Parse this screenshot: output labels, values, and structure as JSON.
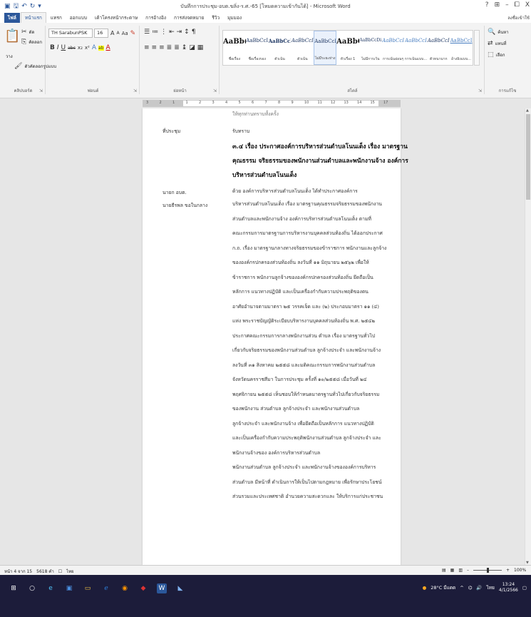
{
  "titlebar": {
    "title": "บันทึกการประชุม-อบต.ฆลิ่ง-ร.ศ.-65 [โหมดความเข้ากันได้] - Microsoft Word",
    "help": "?",
    "restore_ribbon": "⊞",
    "minimize": "–",
    "maximize": "⧠",
    "close": "X"
  },
  "tabs": [
    "ไฟล์",
    "หน้าแรก",
    "แทรก",
    "ออกแบบ",
    "เค้าโครงหน้ากระดาษ",
    "การอ้างอิง",
    "การส่งจดหมาย",
    "รีวิว",
    "มุมมอง"
  ],
  "user": "ลงชื่อเข้าใช้",
  "ribbon": {
    "clipboard": {
      "label": "คลิปบอร์ด",
      "paste": "วาง",
      "cut": "ตัด",
      "copy": "คัดลอก",
      "format_painter": "ตัวคัดลอกรูปแบบ"
    },
    "font": {
      "label": "ฟอนต์",
      "name": "TH SarabunPSK",
      "size": "16",
      "grow": "A",
      "shrink": "A",
      "case": "Aa",
      "clear": "✎",
      "bold": "B",
      "italic": "I",
      "underline": "U",
      "strike": "abc",
      "sub": "x₂",
      "sup": "x²",
      "effects": "A",
      "highlight": "ab",
      "color": "A"
    },
    "paragraph": {
      "label": "ย่อหน้า"
    },
    "styles": {
      "label": "สไตล์",
      "items": [
        {
          "sample": "AaBb(",
          "name": "ชื่อเรื่อง"
        },
        {
          "sample": "AaBbCcI",
          "name": "ชื่อเรื่องรอง"
        },
        {
          "sample": "AaBbCcl",
          "name": "ตัวเน้น"
        },
        {
          "sample": "AaBbCcI",
          "name": "ตัวเน้น"
        },
        {
          "sample": "AaBbCcI",
          "name": "ไม่มีระยะห่าง"
        },
        {
          "sample": "AaBbC",
          "name": "หัวเรื่อง 1"
        },
        {
          "sample": "AaBbCcDi",
          "name": "ไม่มีการเว้น"
        },
        {
          "sample": "AaBbCcI",
          "name": "การเน้นอ่อนๆ"
        },
        {
          "sample": "AaBbCcI",
          "name": "การเน้นแบบ..."
        },
        {
          "sample": "AaBbCcI",
          "name": "ตัวหนามาก"
        },
        {
          "sample": "AaBbCcI",
          "name": "อ้างอิงแบบ..."
        }
      ]
    },
    "editing": {
      "label": "การแก้ไข",
      "find": "ค้นหา",
      "replace": "แทนที่",
      "select": "เลือก"
    }
  },
  "ruler": {
    "numbers": [
      "3",
      "2",
      "1",
      "1",
      "2",
      "3",
      "4",
      "5",
      "6",
      "7",
      "8",
      "9",
      "10",
      "11",
      "12",
      "13",
      "14",
      "15",
      "17"
    ]
  },
  "document": {
    "top_lines": [
      "ให้ทุกท่านทราบทั้งครั้ง"
    ],
    "meeting_label": "ที่ประชุม",
    "meeting_value": "รับทราบ",
    "heading_lines": [
      "๓.๔ เรื่อง ประกาศองค์การบริหารส่วนตำบลโนนเต็ง เรื่อง มาตรฐาน",
      "คุณธรรม จริยธรรมของพนักงานส่วนตำบลและพนักงานจ้าง องค์การ",
      "บริหารส่วนตำบลโนนเต็ง"
    ],
    "speaker1": "นายก อบต.",
    "speaker1_line": "ด้วย องค์การบริหารส่วนตำบลโนนเต็ง ได้ทำประกาศองค์การ",
    "speaker2": "นายธีรพล ขอในกลาง",
    "body_lines": [
      "บริหารส่วนตำบลโนนเต็ง เรื่อง มาตรฐานคุณธรรมจริยธรรมของพนักงาน",
      "ส่วนตำบลและพนักงานจ้าง องค์การบริหารส่วนตำบลโนนเต็ง ตามที่",
      "คณะกรรมการมาตรฐานการบริหารงานบุคคลส่วนท้องถิ่น ได้ออกประกาศ",
      "ก.ถ. เรื่อง มาตรฐานกลางทางจริยธรรมของข้าราชการ พนักงานและลูกจ้าง",
      "ขององค์กรปกครองส่วนท้องถิ่น ลงวันที่ ๑๑ มิถุนายน ๒๕๖๒ เพื่อให้",
      "ข้าราชการ พนักงานลูกจ้างขององค์กรปกครองส่วนท้องถิ่น ยึดถือเป็น",
      "หลักการ แนวทางปฏิบัติ และเป็นเครื่องกำกับความประพฤติของตน",
      "อาศัยอำนาจตามมาตรา ๒๕ วรรคเจ็ด และ (๒) ประกอบมาตรา ๑๑ (๔)",
      "แห่ง พระราชบัญญัติระเบียบบริหารงานบุคคลส่วนท้องถิ่น พ.ศ. ๒๕๔๒",
      "ประกาศคณะกรรมการกลางพนักงานส่วน ตำบล เรื่อง มาตรฐานทั่วไป",
      "เกี่ยวกับจริยธรรมของพนักงานส่วนตำบล ลูกจ้างประจำ และพนักงานจ้าง",
      "ลงวันที่ ๓๑ สิงหาคม ๒๕๕๘ และมติคณะกรรมการพนักงานส่วนตำบล",
      "จังหวัดนครราชสีมา ในการประชุม ครั้งที่ ๑๐/๒๕๕๘ เมื่อวันที่ ๒๔",
      "พฤศจิกายน ๒๕๕๘ เห็นชอบให้กำหนดมาตรฐานทั่วไปเกี่ยวกับจริยธรรม",
      "ของพนักงาน ส่วนตำบล ลูกจ้างประจำ และพนักงานส่วนตำบล",
      "ลูกจ้างประจำ และพนักงานจ้าง เพื่อยึดถือเป็นหลักการ แนวทางปฏิบัติ",
      "และเป็นเครื่องกำกับความประพฤติพนักงานส่วนตำบล ลูกจ้างประจำ และ",
      "พนักงานจ้างของ องค์การบริหารส่วนตำบล",
      "พนักงานส่วนตำบล ลูกจ้างประจำ และพนักงานจ้างขององค์การบริหาร",
      "ส่วนตำบล มีหน้าที่ ดำเนินการให้เป็นไปตามกฎหมาย เพื่อรักษาประโยชน์",
      "ส่วนรวมและประเทศชาติ อำนวยความสะดวกและ ให้บริการแก่ประชาชน"
    ]
  },
  "statusbar": {
    "page": "หน้า 4 จาก 15",
    "words": "5618 คำ",
    "lang": "ไทย",
    "zoom": "100%"
  },
  "taskbar": {
    "weather": "28°C มีแดด",
    "lang": "ไทย",
    "time": "13:24",
    "date": "4/1/2566"
  },
  "colors": {
    "word_blue": "#2b579a",
    "taskbar": "#1c1c3a"
  }
}
